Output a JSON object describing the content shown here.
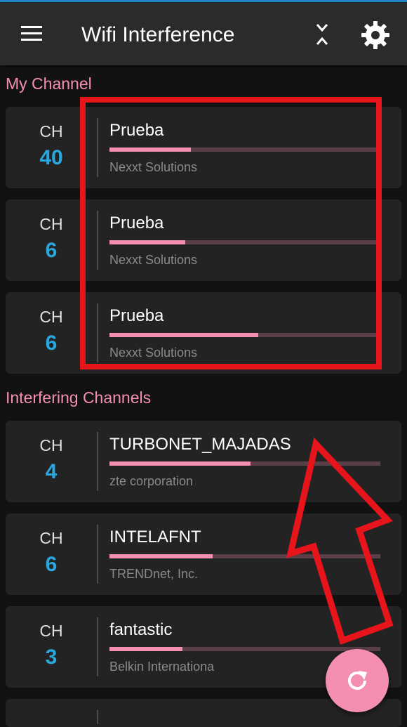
{
  "app": {
    "title": "Wifi Interference",
    "icons": {
      "menu": "hamburger-menu-icon",
      "collapse": "collapse-arrows-icon",
      "settings": "gear-icon",
      "refresh": "refresh-icon"
    }
  },
  "sections": {
    "my_channel_title": "My Channel",
    "interfering_title": "Interfering Channels"
  },
  "my_channel": [
    {
      "ch_label": "CH",
      "ch": "40",
      "ssid": "Prueba",
      "vendor": "Nexxt Solutions",
      "signal": 0.3
    },
    {
      "ch_label": "CH",
      "ch": "6",
      "ssid": "Prueba",
      "vendor": "Nexxt Solutions",
      "signal": 0.28
    },
    {
      "ch_label": "CH",
      "ch": "6",
      "ssid": "Prueba",
      "vendor": "Nexxt Solutions",
      "signal": 0.55
    }
  ],
  "interfering": [
    {
      "ch_label": "CH",
      "ch": "4",
      "ssid": "TURBONET_MAJADAS",
      "vendor": "zte corporation",
      "signal": 0.52
    },
    {
      "ch_label": "CH",
      "ch": "6",
      "ssid": "INTELAFNT",
      "vendor": "TRENDnet, Inc.",
      "signal": 0.38
    },
    {
      "ch_label": "CH",
      "ch": "3",
      "ssid": "fantastic",
      "vendor": "Belkin Internationa",
      "signal": 0.27
    }
  ],
  "colors": {
    "accent_pink": "#f48fb1",
    "channel_blue": "#29a8e0",
    "annotation_red": "#e8141c"
  }
}
